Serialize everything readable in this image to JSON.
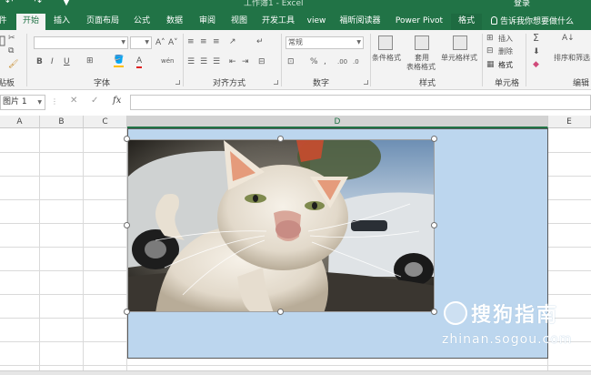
{
  "title_bar": {
    "quick_access": "↶ ↷ ▼",
    "window_title": "工作簿1 - Excel",
    "login": "登录"
  },
  "tabs": [
    {
      "label": "件"
    },
    {
      "label": "开始"
    },
    {
      "label": "插入"
    },
    {
      "label": "页面布局"
    },
    {
      "label": "公式"
    },
    {
      "label": "数据"
    },
    {
      "label": "审阅"
    },
    {
      "label": "视图"
    },
    {
      "label": "开发工具"
    },
    {
      "label": "view"
    },
    {
      "label": "福昕阅读器"
    },
    {
      "label": "Power Pivot"
    },
    {
      "label": "格式"
    }
  ],
  "tell_me": "告诉我你想要做什么",
  "ribbon": {
    "clipboard_label": "贴板",
    "font_label": "字体",
    "font_bold": "B",
    "font_italic": "I",
    "font_underline": "U",
    "font_grow": "A˄",
    "font_shrink": "A˅",
    "font_color": "A",
    "alignment_label": "对齐方式",
    "number_label": "数字",
    "number_format": "常规",
    "percent": "%",
    "comma": ",",
    "styles_label": "样式",
    "conditional_format": "条件格式",
    "table_format_1": "套用",
    "table_format_2": "表格格式",
    "cell_styles": "单元格样式",
    "cells_label": "单元格",
    "insert": "插入",
    "delete": "删除",
    "format": "格式",
    "editing_label": "编辑",
    "sort_filter": "排序和筛选",
    "sum": "Σ"
  },
  "formula_bar": {
    "name_box": "图片 1",
    "fx": "fx",
    "cancel": "✕",
    "enter": "✓",
    "dots": "⋮",
    "content": ""
  },
  "columns": [
    {
      "letter": "A"
    },
    {
      "letter": "B"
    },
    {
      "letter": "C"
    },
    {
      "letter": "D"
    },
    {
      "letter": "E"
    }
  ],
  "colors": {
    "excel_green": "#217346",
    "selection_fill": "#bcd6ee"
  },
  "watermark": {
    "brand": "搜狗指南",
    "domain": "zhinan.sogou.com"
  }
}
